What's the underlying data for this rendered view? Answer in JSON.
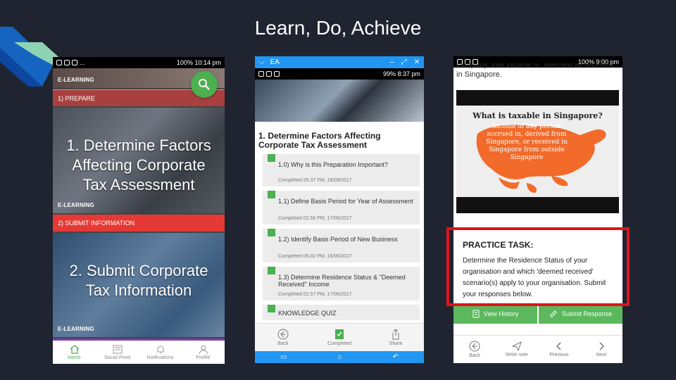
{
  "slide": {
    "title": "Learn, Do, Achieve"
  },
  "colors": {
    "background": "#1f2430",
    "accent_green": "#4caf50",
    "accent_red": "#e53935",
    "android_blue": "#2196f3",
    "highlight_red": "#e0141a"
  },
  "phone1": {
    "status": {
      "battery": "100%",
      "time": "10:14 pm",
      "dots": "..."
    },
    "sections": [
      {
        "tag": "E-LEARNING",
        "bar_label": "1) PREPARE",
        "heading": "1. Determine Factors Affecting Corporate Tax Assessment"
      },
      {
        "tag": "E-LEARNING",
        "bar_label": "2) SUBMIT INFORMATION",
        "heading": "2. Submit Corporate Tax Information"
      },
      {
        "tag": "E-LEARNING"
      }
    ],
    "search_icon": "search-icon",
    "nav": [
      {
        "label": "Home",
        "icon": "home-icon"
      },
      {
        "label": "Social Feed",
        "icon": "feed-icon"
      },
      {
        "label": "Notifications",
        "icon": "bell-icon"
      },
      {
        "label": "Profile",
        "icon": "profile-icon"
      }
    ]
  },
  "phone2": {
    "window_title": "EA",
    "status": {
      "battery": "99%",
      "time": "8:37 pm"
    },
    "heading": "1. Determine Factors Affecting Corporate Tax Assessment",
    "items": [
      {
        "title": "1.0) Why is this Preparation Important?",
        "completed": "Completed 05.37 PM, 18/09/2017"
      },
      {
        "title": "1.1) Define Basis Period for Year of Assessment",
        "completed": "Completed 02.56 PM, 17/06/2017"
      },
      {
        "title": "1.2) Identify Basis Period of New Business",
        "completed": "Completed 06.02 PM, 16/06/2017"
      },
      {
        "title": "1.3) Determine Residence Status & \"Deemed Received\" Income",
        "completed": "Completed 02.57 PM, 17/06/2017"
      },
      {
        "title": "KNOWLEDGE QUIZ",
        "completed": ""
      }
    ],
    "bottom": [
      {
        "label": "Back",
        "icon": "back-circle-icon"
      },
      {
        "label": "Completed",
        "icon": "flag-icon"
      },
      {
        "label": "Share",
        "icon": "share-icon"
      }
    ]
  },
  "phone3": {
    "status": {
      "battery": "100%",
      "time": "9:00 pm"
    },
    "intro_partial": "company, that income is \"deemed as received\"",
    "intro_line": "in Singapore.",
    "video": {
      "title": "What is taxable in Singapore?",
      "body": "Income of any person accrued in, derived from Singapore, or received in Singapore from outside Singapore"
    },
    "task": {
      "heading": "PRACTICE TASK:",
      "body": "Determine the Residence Status of your organisation and which 'deemed received' scenario(s) apply to your organisation. Submit your responses below."
    },
    "actions": [
      {
        "label": "View History",
        "icon": "history-icon"
      },
      {
        "label": "Submit Response",
        "icon": "pencil-icon"
      }
    ],
    "bottom": [
      {
        "label": "Back",
        "icon": "back-circle-icon"
      },
      {
        "label": "Write note",
        "icon": "send-icon"
      },
      {
        "label": "Previous",
        "icon": "chevron-left-icon"
      },
      {
        "label": "Next",
        "icon": "chevron-right-icon"
      }
    ]
  }
}
